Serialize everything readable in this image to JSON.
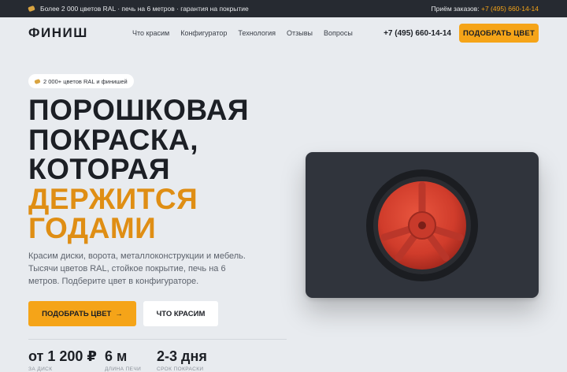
{
  "topbar": {
    "promo_text": "Более 2 000 цветов RAL · печь на 6 метров · гарантия на покрытие",
    "orders_label": "Приём заказов:",
    "orders_phone": "+7 (495) 660-14-14"
  },
  "header": {
    "logo": "ФИНИШ",
    "nav": [
      "Что красим",
      "Конфигуратор",
      "Технология",
      "Отзывы",
      "Вопросы"
    ],
    "phone": "+7 (495) 660-14-14",
    "cta_label": "ПОДОБРАТЬ ЦВЕТ"
  },
  "hero": {
    "badge": "2 000+ цветов RAL и финишей",
    "title_lines": [
      "ПОРОШКОВАЯ",
      "ПОКРАСКА,",
      "КОТОРАЯ"
    ],
    "title_accent_lines": [
      "ДЕРЖИТСЯ",
      "ГОДАМИ"
    ],
    "text": "Красим диски, ворота, металлоконструкции и мебель. Тысячи цветов RAL, стойкое покрытие, печь на 6 метров. Подберите цвет в конфигураторе.",
    "primary_button": "ПОДОБРАТЬ ЦВЕТ",
    "primary_arrow": "→",
    "secondary_button": "ЧТО КРАСИМ"
  },
  "stats": [
    {
      "value": "от 1 200 ₽",
      "label": "ЗА ДИСК"
    },
    {
      "value": "6 м",
      "label": "ДЛИНА ПЕЧИ"
    },
    {
      "value": "2-3 дня",
      "label": "СРОК ПОКРАСКИ"
    }
  ],
  "colors": {
    "accent": "#f5a418",
    "title_accent": "#df8e14",
    "topbar_bg": "#262a31",
    "page_bg": "#e8ebef",
    "wheel_red": "#d9422f",
    "panel_bg": "#30343c"
  },
  "icons": {
    "promo": "paint-palette-icon",
    "arrow": "arrow-right-icon",
    "wheel": "wheel-illustration"
  }
}
